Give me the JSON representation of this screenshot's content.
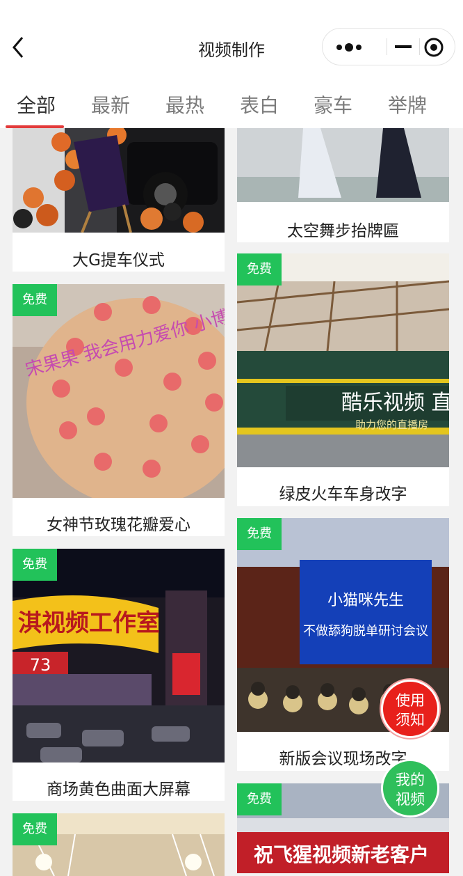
{
  "header": {
    "title": "视频制作"
  },
  "tabs": [
    "全部",
    "最新",
    "最热",
    "表白",
    "豪车",
    "举牌"
  ],
  "badge": "免费",
  "left": [
    {
      "caption": "大G提车仪式"
    },
    {
      "caption": "女神节玫瑰花瓣爱心",
      "badge": true,
      "overlay": "宋果果 我会用力爱你 小博士"
    },
    {
      "caption": "商场黄色曲面大屏幕",
      "badge": true,
      "overlay": "淇视频工作室",
      "sub": "73"
    },
    {
      "caption": "",
      "badge": true
    }
  ],
  "right": [
    {
      "caption": "太空舞步抬牌匾"
    },
    {
      "caption": "绿皮火车车身改字",
      "badge": true,
      "overlay": "酷乐视频 直播",
      "sub": "助力您的直播房"
    },
    {
      "caption": "新版会议现场改字",
      "badge": true,
      "overlay": "小猫咪先生",
      "sub": "不做舔狗脱单研讨会议"
    },
    {
      "caption": "",
      "badge": true,
      "overlay": "祝飞猩视频新老客户"
    }
  ],
  "floats": {
    "notice": [
      "使用",
      "须知"
    ],
    "myvideo": [
      "我的",
      "视频"
    ]
  },
  "colors": {
    "accent": "#e33b3b",
    "badge": "#22c25a",
    "notice": "#e8201b",
    "myvideo": "#2fbf5b"
  }
}
